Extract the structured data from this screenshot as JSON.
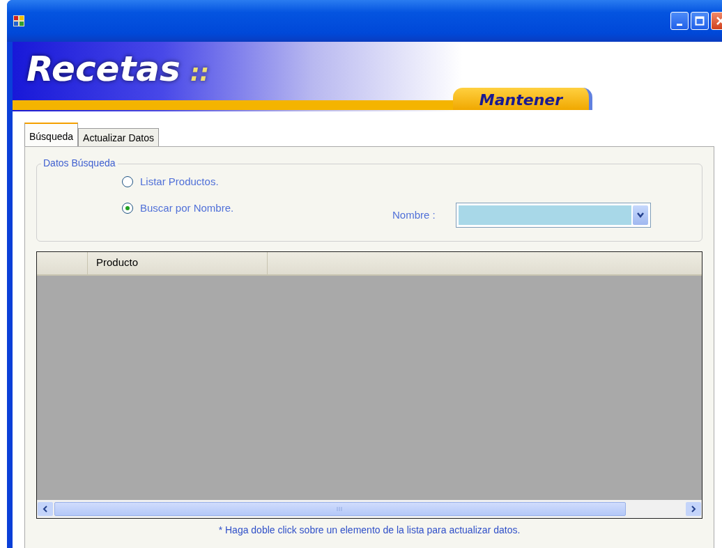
{
  "banner": {
    "title": "Recetas",
    "separator": "::",
    "badge": "Mantener"
  },
  "tabs": [
    {
      "label": "Búsqueda",
      "selected": true
    },
    {
      "label": "Actualizar Datos",
      "selected": false
    }
  ],
  "search_group": {
    "legend": "Datos Búsqueda",
    "options": [
      {
        "label": "Listar Productos.",
        "selected": false
      },
      {
        "label": "Buscar por Nombre.",
        "selected": true
      }
    ],
    "name_label": "Nombre :"
  },
  "grid": {
    "columns": [
      "Producto"
    ]
  },
  "footer_note": "* Haga doble click sobre un elemento de la lista para actualizar datos."
}
